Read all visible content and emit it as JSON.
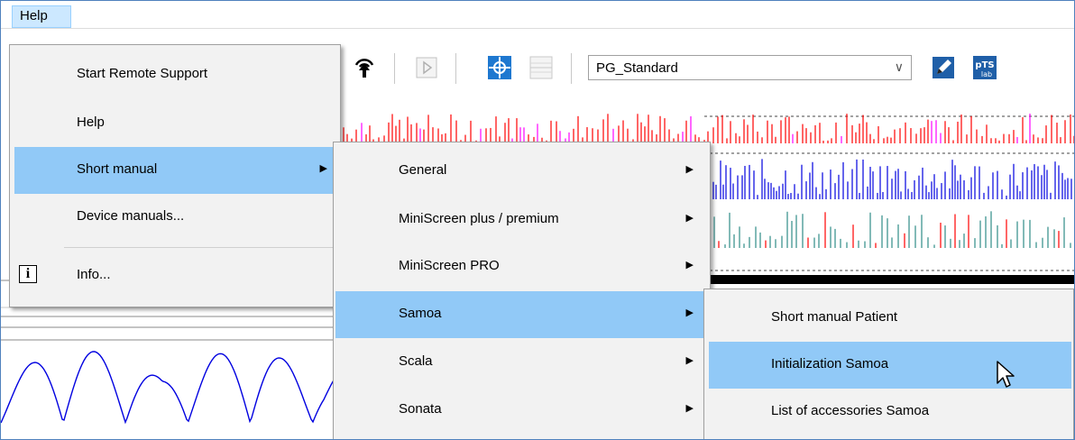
{
  "menubar": {
    "help_label": "Help"
  },
  "toolbar": {
    "combo_value": "PG_Standard",
    "brand_badge": "pTS lab"
  },
  "help_menu": {
    "items": [
      {
        "label": "Start Remote Support"
      },
      {
        "label": "Help"
      },
      {
        "label": "Short manual",
        "has_submenu": true,
        "highlighted": true
      },
      {
        "label": "Device manuals..."
      },
      {
        "label": "Info...",
        "icon": "info-icon"
      }
    ]
  },
  "short_manual_menu": {
    "items": [
      {
        "label": "General",
        "has_submenu": true
      },
      {
        "label": "MiniScreen plus / premium",
        "has_submenu": true
      },
      {
        "label": "MiniScreen PRO",
        "has_submenu": true
      },
      {
        "label": "Samoa",
        "has_submenu": true,
        "highlighted": true
      },
      {
        "label": "Scala",
        "has_submenu": true
      },
      {
        "label": "Sonata",
        "has_submenu": true
      }
    ]
  },
  "samoa_menu": {
    "items": [
      {
        "label": "Short manual Patient"
      },
      {
        "label": "Initialization Samoa",
        "highlighted": true
      },
      {
        "label": "List of accessories Samoa"
      }
    ]
  },
  "colors": {
    "menu_highlight": "#91c9f7",
    "menubar_active": "#cce8ff",
    "trace_red": "#ff0000",
    "trace_blue": "#0000e0",
    "trace_teal": "#2e8b87",
    "trace_magenta": "#ff00ff"
  }
}
